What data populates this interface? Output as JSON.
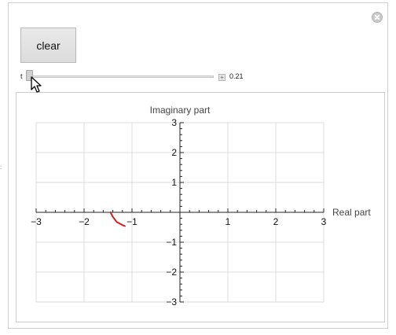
{
  "controls": {
    "clear_label": "clear",
    "slider_label": "t",
    "slider_value_text": "0.21",
    "slider_fraction": 0.0,
    "plus_glyph": "+"
  },
  "icons": {
    "close": "close-icon",
    "cursor": "mouse-pointer-icon"
  },
  "left_mark": ":",
  "chart_data": {
    "type": "line",
    "xlabel": "Real part",
    "ylabel": "Imaginary part",
    "xlim": [
      -3,
      3
    ],
    "ylim": [
      -3,
      3
    ],
    "xticks": [
      "-3",
      "-2",
      "-1",
      "1",
      "2",
      "3"
    ],
    "yticks": [
      "-3",
      "-2",
      "-1",
      "1",
      "2",
      "3"
    ],
    "xtick_values": [
      -3,
      -2,
      -1,
      1,
      2,
      3
    ],
    "ytick_values": [
      -3,
      -2,
      -1,
      1,
      2,
      3
    ],
    "grid": true,
    "series": [
      {
        "color": "#cc1f1f",
        "points": [
          [
            -1.45,
            0.0
          ],
          [
            -1.4,
            -0.15
          ],
          [
            -1.32,
            -0.32
          ],
          [
            -1.18,
            -0.44
          ],
          [
            -1.15,
            -0.46
          ]
        ]
      }
    ]
  }
}
